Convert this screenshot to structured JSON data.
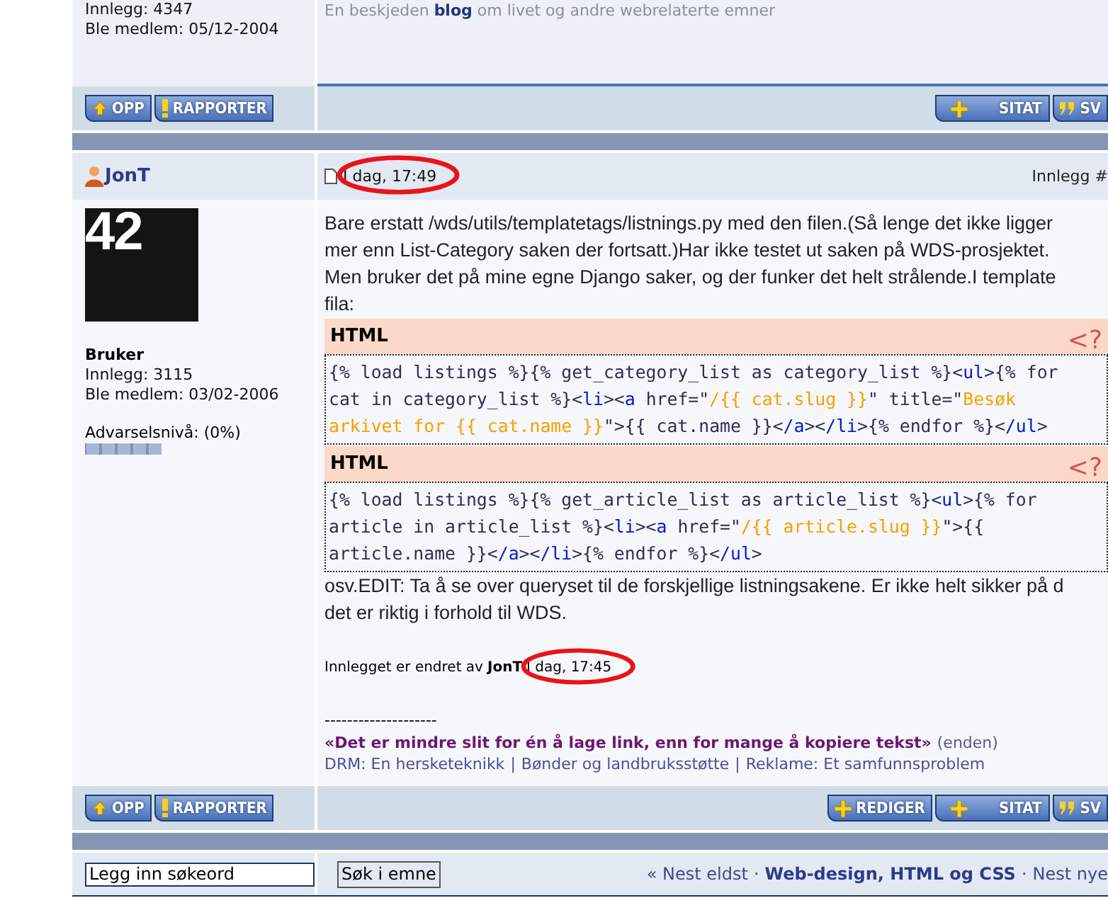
{
  "previous_post": {
    "author_stats": [
      "Innlegg: 4347",
      "Ble medlem: 05/12-2004"
    ],
    "signature": "En beskjeden **blog** om livet og andre webrelaterte emner",
    "left_buttons": [
      {
        "kind": "up",
        "label": "OPP"
      },
      {
        "kind": "report",
        "label": "RAPPORTER"
      }
    ],
    "right_buttons": [
      {
        "kind": "quote",
        "label": "SITAT"
      },
      {
        "kind": "reply",
        "label": "SV"
      }
    ]
  },
  "post": {
    "author": "JonT",
    "date": "I dag, 17:49",
    "date_circled": true,
    "post_number": "Innlegg #",
    "avatar_text": "42",
    "rank": "Bruker",
    "author_stats": [
      "Innlegg: 3115",
      "Ble medlem: 03/02-2006"
    ],
    "warning_label": "Advarselsnivå: (0%)",
    "warning_meter": {
      "level": 0
    },
    "body": [
      {
        "kind": "text",
        "lines": [
          "Bare erstatt /wds/utils/templatetags/listnings.py med den filen.(Så lenge det ikke ligger",
          "mer enn List-Category saken der fortsatt.)Har ikke testet ut saken på WDS-prosjektet.",
          "Men bruker det på mine egne Django saker, og der funker det helt strålende.I template",
          "fila:"
        ]
      },
      {
        "kind": "code",
        "title": "HTML",
        "badge": "<?",
        "lines": [
          [
            {
              "kind": "plain",
              "text": "{% load listings %}{% get_category_list as category_list %}<"
            },
            {
              "kind": "tag",
              "text": "ul"
            },
            {
              "kind": "plain",
              "text": ">{% for"
            }
          ],
          [
            {
              "kind": "plain",
              "text": "cat in category_list %}<"
            },
            {
              "kind": "tag",
              "text": "li"
            },
            {
              "kind": "plain",
              "text": "><"
            },
            {
              "kind": "tag",
              "text": "a"
            },
            {
              "kind": "plain",
              "text": " href=\""
            },
            {
              "kind": "string",
              "text": "/{{ cat.slug }}"
            },
            {
              "kind": "plain",
              "text": "\" title=\""
            },
            {
              "kind": "string",
              "text": "Besøk"
            }
          ],
          [
            {
              "kind": "string",
              "text": "arkivet for {{ cat.name }}"
            },
            {
              "kind": "plain",
              "text": "\">{{ cat.name }}<"
            },
            {
              "kind": "tag",
              "text": "/a"
            },
            {
              "kind": "plain",
              "text": "><"
            },
            {
              "kind": "tag",
              "text": "/li"
            },
            {
              "kind": "plain",
              "text": ">{% endfor %}<"
            },
            {
              "kind": "tag",
              "text": "/ul"
            },
            {
              "kind": "plain",
              "text": ">"
            }
          ]
        ]
      },
      {
        "kind": "code",
        "title": "HTML",
        "badge": "<?",
        "lines": [
          [
            {
              "kind": "plain",
              "text": "{% load listings %}{% get_article_list as article_list %}<"
            },
            {
              "kind": "tag",
              "text": "ul"
            },
            {
              "kind": "plain",
              "text": ">{% for"
            }
          ],
          [
            {
              "kind": "plain",
              "text": "article in article_list %}<"
            },
            {
              "kind": "tag",
              "text": "li"
            },
            {
              "kind": "plain",
              "text": "><"
            },
            {
              "kind": "tag",
              "text": "a"
            },
            {
              "kind": "plain",
              "text": " href=\""
            },
            {
              "kind": "string",
              "text": "/{{ article.slug }}"
            },
            {
              "kind": "plain",
              "text": "\">{{"
            }
          ],
          [
            {
              "kind": "plain",
              "text": "article.name }}<"
            },
            {
              "kind": "tag",
              "text": "/a"
            },
            {
              "kind": "plain",
              "text": "><"
            },
            {
              "kind": "tag",
              "text": "/li"
            },
            {
              "kind": "plain",
              "text": ">{% endfor %}<"
            },
            {
              "kind": "tag",
              "text": "/ul"
            },
            {
              "kind": "plain",
              "text": ">"
            }
          ]
        ]
      },
      {
        "kind": "text",
        "lines": [
          "osv.EDIT: Ta å se over queryset til de forskjellige listningsakene. Er ikke helt sikker på d",
          "det er riktig i forhold til WDS."
        ]
      }
    ],
    "edit_note": {
      "prefix": "Innlegget er endret av",
      "editor": "JonT",
      "date": "I dag, 17:45",
      "date_circled": true
    },
    "signature": {
      "rule": "--------------------",
      "quote": "«Det er mindre slit for én å lage link, enn for mange å kopiere tekst»",
      "suffix": "(enden)",
      "links": [
        "DRM: En hersketeknikk",
        "Bønder og landbruksstøtte",
        "Reklame: Et samfunnsproblem"
      ],
      "link_separator": "|"
    },
    "left_buttons": [
      {
        "kind": "up",
        "label": "OPP"
      },
      {
        "kind": "report",
        "label": "RAPPORTER"
      }
    ],
    "right_buttons": [
      {
        "kind": "edit",
        "label": "REDIGER"
      },
      {
        "kind": "quote",
        "label": "SITAT"
      },
      {
        "kind": "reply",
        "label": "SV"
      }
    ]
  },
  "footer": {
    "search": {
      "value": "Legg inn søkeord"
    },
    "search_button": "Søk i emne",
    "nav": [
      {
        "kind": "link",
        "label": "« Nest eldst"
      },
      {
        "kind": "separator",
        "label": "·"
      },
      {
        "kind": "current",
        "label": "Web-design, HTML og CSS"
      },
      {
        "kind": "separator",
        "label": "·"
      },
      {
        "kind": "link",
        "label": "Nest nye"
      }
    ]
  }
}
